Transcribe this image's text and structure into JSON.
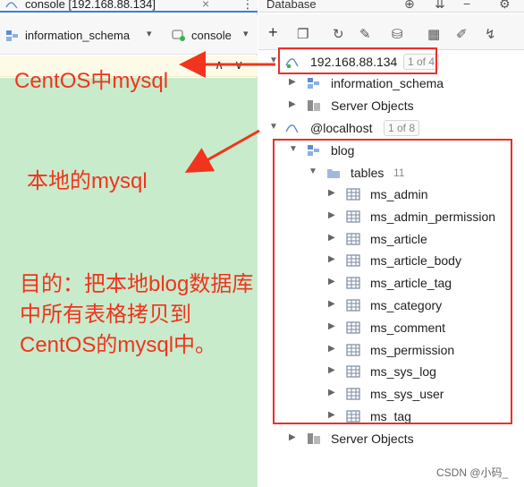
{
  "console_tab": {
    "title": "console [192.168.88.134]"
  },
  "editor_toolbar": {
    "schema": "information_schema",
    "console": "console"
  },
  "database_panel": {
    "title": "Database",
    "remote": {
      "host": "192.168.88.134",
      "badge": "1 of 4"
    },
    "remote_children": [
      "information_schema",
      "Server Objects"
    ],
    "local": {
      "host": "@localhost",
      "badge": "1 of 8"
    },
    "blog": {
      "name": "blog",
      "tables_label": "tables",
      "tables_count": "11"
    },
    "tables": [
      "ms_admin",
      "ms_admin_permission",
      "ms_article",
      "ms_article_body",
      "ms_article_tag",
      "ms_category",
      "ms_comment",
      "ms_permission",
      "ms_sys_log",
      "ms_sys_user",
      "ms_tag"
    ],
    "local_server_objects": "Server Objects"
  },
  "annotations": {
    "remote_note": "CentOS中mysql",
    "local_note": "本地的mysql",
    "goal_note": "目的：把本地blog数据库中所有表格拷贝到CentOS的mysql中。"
  },
  "watermark": "CSDN @小码_",
  "colors": {
    "annotation_red": "#f0341e",
    "editor_bg": "#c8ebcb",
    "accent_blue": "#3d7ddb"
  }
}
